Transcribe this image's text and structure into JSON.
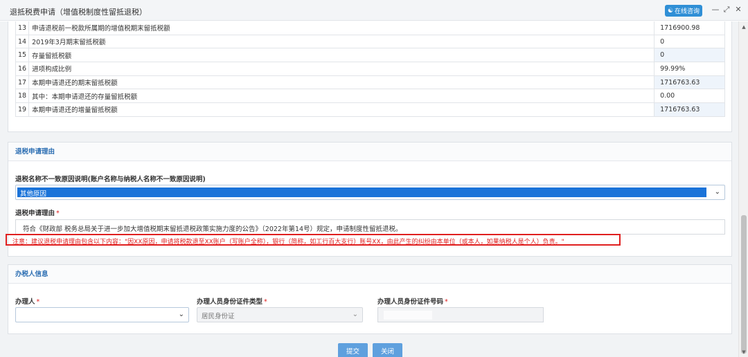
{
  "window": {
    "title": "退抵税费申请（增值税制度性留抵退税）",
    "consult_label": "在线咨询"
  },
  "table": {
    "rows": [
      {
        "num": "13",
        "label": "申请退税前一税款所属期的增值税期末留抵税额",
        "value": "1716900.98",
        "shaded": false
      },
      {
        "num": "14",
        "label": "2019年3月期末留抵税额",
        "value": "0",
        "shaded": false
      },
      {
        "num": "15",
        "label": "存量留抵税额",
        "value": "0",
        "shaded": true
      },
      {
        "num": "16",
        "label": "进项构成比例",
        "value": "99.99%",
        "shaded": false
      },
      {
        "num": "17",
        "label": "本期申请退还的期末留抵税额",
        "value": "1716763.63",
        "shaded": true
      },
      {
        "num": "18",
        "label": "其中：本期申请退还的存量留抵税额",
        "value": "0.00",
        "shaded": false
      },
      {
        "num": "19",
        "label": "本期申请退还的增量留抵税额",
        "value": "1716763.63",
        "shaded": true
      }
    ]
  },
  "reason": {
    "section_title": "退税申请理由",
    "mismatch_label": "退税名称不一致原因说明(账户名称与纳税人名称不一致原因说明)",
    "mismatch_value": "其他原因",
    "reason_label": "退税申请理由",
    "required_mark": "*",
    "reason_text": "符合《财政部 税务总局关于进一步加大增值税期末留抵退税政策实施力度的公告》（2022年第14号）规定，申请制度性留抵退税。",
    "notice": "注意：建议退税申请理由包含以下内容：\"因XX原因，申请将税款退至XX账户（写账户全称），银行（简称，如工行百大支行）账号XX，由此产生的纠纷由本单位（或本人，如果纳税人是个人）负责。\""
  },
  "handler": {
    "section_title": "办税人信息",
    "person_label": "办理人",
    "id_type_label": "办理人员身份证件类型",
    "id_type_value": "居民身份证",
    "id_number_label": "办理人员身份证件号码",
    "required_mark": "*"
  },
  "footer": {
    "submit_label": "提交",
    "close_label": "关闭"
  }
}
